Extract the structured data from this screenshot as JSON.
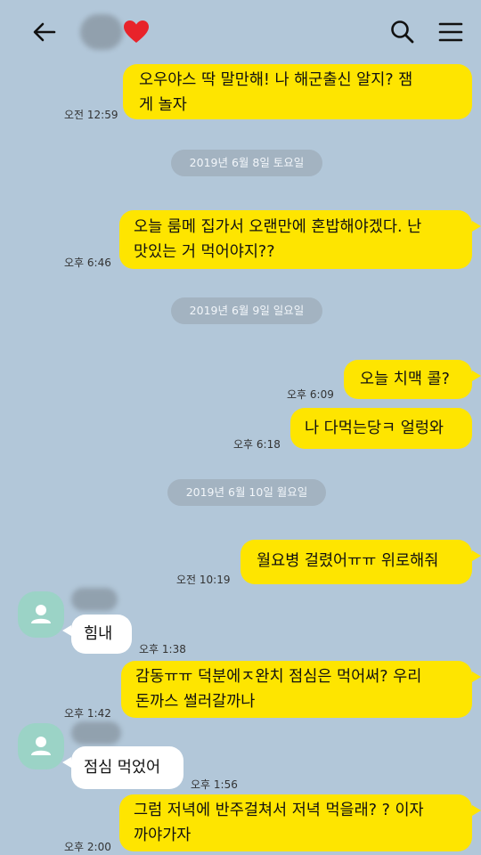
{
  "header": {
    "back_icon": "arrow-left-icon",
    "heart_icon": "heart-icon",
    "heart_color": "#e8232a",
    "search_icon": "search-icon",
    "menu_icon": "hamburger-menu-icon"
  },
  "colors": {
    "background": "#b2c7d9",
    "my_bubble": "#fee500",
    "their_bubble": "#ffffff",
    "avatar": "#9bd3c6"
  },
  "messages": [
    {
      "id": "m1",
      "sender": "me",
      "text": "오우야스 딱 말만해! 나 해군출신 알지? 잼\n게 놀자",
      "time": "오전 12:59"
    },
    {
      "id": "d1",
      "type": "date",
      "text": "2019년 6월 8일 토요일"
    },
    {
      "id": "m2",
      "sender": "me",
      "text": "오늘 룸메 집가서 오랜만에 혼밥해야겠다. 난\n맛있는 거 먹어야지??",
      "time": "오후 6:46"
    },
    {
      "id": "d2",
      "type": "date",
      "text": "2019년 6월 9일 일요일"
    },
    {
      "id": "m3",
      "sender": "me",
      "text": "오늘 치맥 콜?",
      "time": "오후 6:09"
    },
    {
      "id": "m4",
      "sender": "me",
      "text": "나 다먹는당ㅋ 얼렁와",
      "time": "오후 6:18"
    },
    {
      "id": "d3",
      "type": "date",
      "text": "2019년 6월 10일 월요일"
    },
    {
      "id": "m5",
      "sender": "me",
      "text": "월요병 걸렸어ㅠㅠ 위로해줘",
      "time": "오전 10:19"
    },
    {
      "id": "m6",
      "sender": "them",
      "text": "힘내",
      "time": "오후 1:38"
    },
    {
      "id": "m7",
      "sender": "me",
      "text": "감동ㅠㅠ 덕분에ㅈ완치 점심은 먹어써? 우리\n돈까스 썰러갈까나",
      "time": "오후 1:42"
    },
    {
      "id": "m8",
      "sender": "them",
      "text": "점심 먹었어",
      "time": "오후 1:56"
    },
    {
      "id": "m9",
      "sender": "me",
      "text": "그럼 저녁에 반주걸쳐서 저녁 먹을래? ? 이자\n까야가자",
      "time": "오후 2:00"
    }
  ]
}
